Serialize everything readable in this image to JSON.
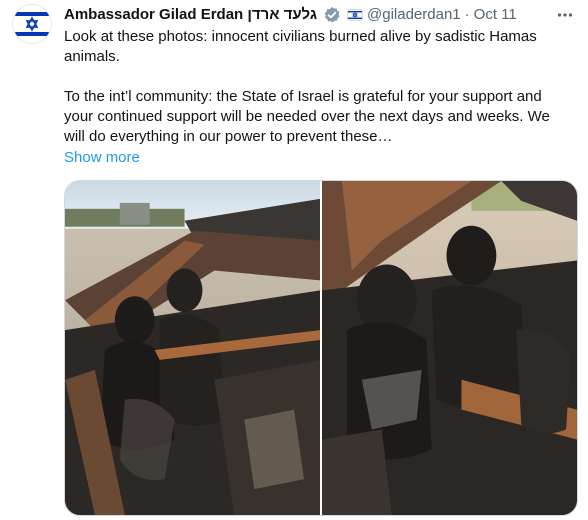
{
  "author": {
    "display_name": "Ambassador Gilad Erdan גלעד ארדן",
    "handle": "@giladerdan1",
    "separator": "·",
    "date": "Oct 11",
    "avatar_icon": "israel-flag-avatar",
    "badge_icon": "government-verified-badge-icon"
  },
  "tweet": {
    "paragraphs": [
      "Look at these photos: innocent civilians burned alive by sadistic Hamas animals.",
      "To the int’l community: the State of Israel is grateful for your support and your continued support will be needed over the next days and weeks. We will do everything in our power to prevent these…"
    ],
    "show_more_label": "Show more"
  },
  "media": {
    "photo_count": 2,
    "photos": [
      {
        "name": "burned-car-photo-1"
      },
      {
        "name": "burned-car-photo-2"
      }
    ]
  },
  "colors": {
    "text": "#0f1419",
    "secondary": "#536471",
    "link": "#1d9bf0",
    "border": "#cfd9de",
    "flag_blue": "#0038b8"
  },
  "more_icon": "ellipsis-more-icon"
}
